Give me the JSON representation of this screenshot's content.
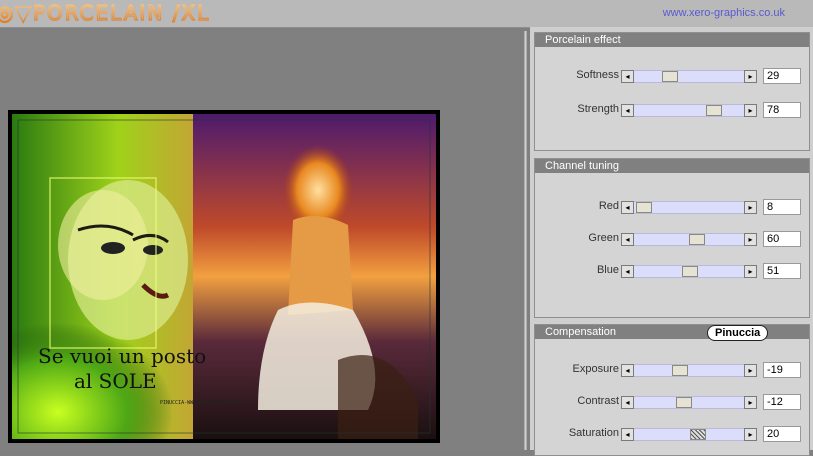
{
  "header": {
    "logo_text": "◎▼PORCELAIN /XL",
    "url": "www.xero-graphics.co.uk"
  },
  "preview": {
    "image_caption_line1": "Se vuoi un posto",
    "image_caption_line2": "al SOLE",
    "image_credit": "PINUCCIA-WWW.MAIGNEGRAPHICS.IT"
  },
  "panel": {
    "porcelain": {
      "title": "Porcelain effect",
      "rows": [
        {
          "label": "Softness",
          "value": "29",
          "fraction": 0.29
        },
        {
          "label": "Strength",
          "value": "78",
          "fraction": 0.78
        }
      ]
    },
    "channel": {
      "title": "Channel tuning",
      "rows": [
        {
          "label": "Red",
          "value": "8",
          "fraction": 0.08
        },
        {
          "label": "Green",
          "value": "60",
          "fraction": 0.6
        },
        {
          "label": "Blue",
          "value": "51",
          "fraction": 0.51
        }
      ]
    },
    "compensation": {
      "title": "Compensation",
      "badge": "Pinuccia",
      "rows": [
        {
          "label": "Exposure",
          "value": "-19",
          "fraction": 0.405
        },
        {
          "label": "Contrast",
          "value": "-12",
          "fraction": 0.44
        },
        {
          "label": "Saturation",
          "value": "20",
          "fraction": 0.6
        }
      ]
    }
  },
  "icons": {
    "arrow_left": "◂",
    "arrow_right": "▸"
  }
}
